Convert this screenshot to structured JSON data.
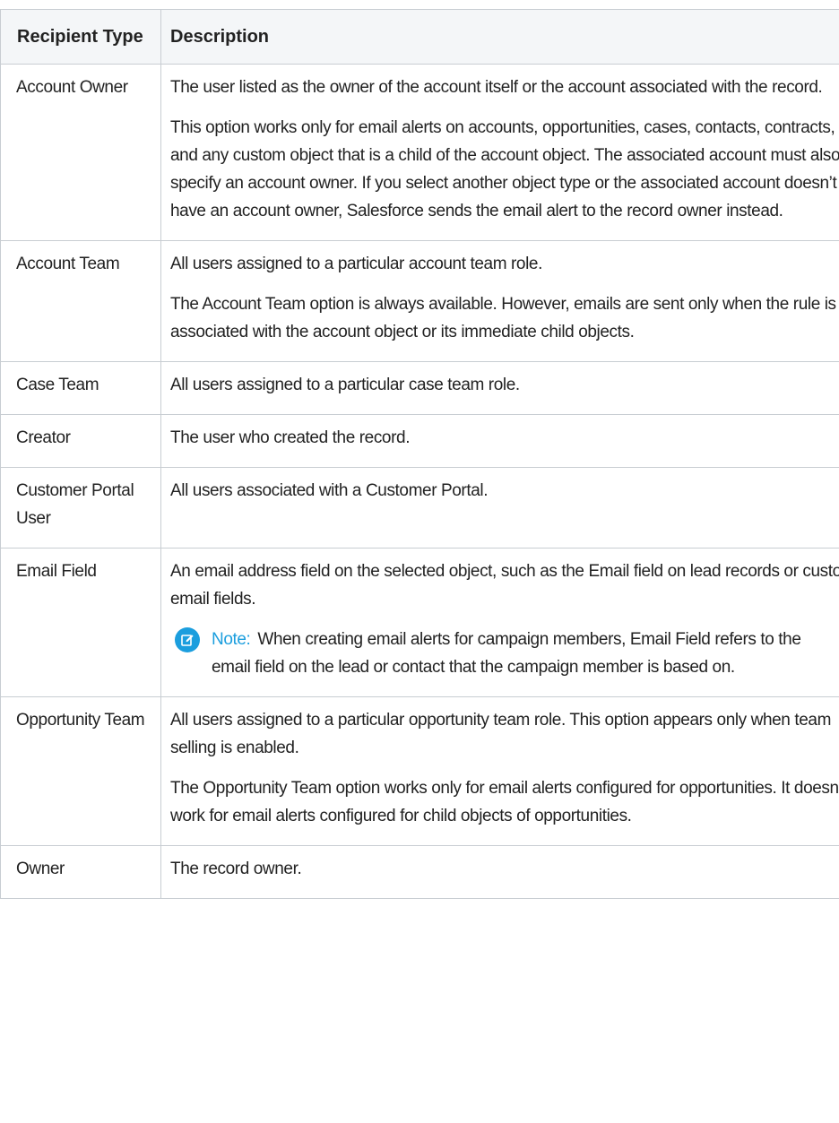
{
  "header": {
    "recipient_type": "Recipient Type",
    "description": "Description"
  },
  "rows": [
    {
      "type": "Account Owner",
      "paragraphs": [
        "The user listed as the owner of the account itself or the account associated with the record.",
        "This option works only for email alerts on accounts, opportunities, cases, contacts, contracts, and any custom object that is a child of the account object. The associated account must also specify an account owner. If you select another object type or the associated account doesn’t have an account owner, Salesforce sends the email alert to the record owner instead."
      ]
    },
    {
      "type": "Account Team",
      "paragraphs": [
        "All users assigned to a particular account team role.",
        "The Account Team option is always available. However, emails are sent only when the rule is associated with the account object or its immediate child objects."
      ]
    },
    {
      "type": "Case Team",
      "paragraphs": [
        "All users assigned to a particular case team role."
      ]
    },
    {
      "type": "Creator",
      "paragraphs": [
        "The user who created the record."
      ]
    },
    {
      "type": "Customer Portal User",
      "paragraphs": [
        "All users associated with a Customer Portal."
      ]
    },
    {
      "type": "Email Field",
      "paragraphs": [
        "An email address field on the selected object, such as the Email field on lead records or custom email fields."
      ],
      "note": {
        "icon": "edit-note-icon",
        "label": "Note:",
        "text": "When creating email alerts for campaign members, Email Field refers to the email field on the lead or contact that the campaign member is based on."
      }
    },
    {
      "type": "Opportunity Team",
      "paragraphs": [
        "All users assigned to a particular opportunity team role. This option appears only when team selling is enabled.",
        "The Opportunity Team option works only for email alerts configured for opportunities. It doesn’t work for email alerts configured for child objects of opportunities."
      ]
    },
    {
      "type": "Owner",
      "paragraphs": [
        "The record owner."
      ]
    }
  ],
  "colors": {
    "header_background": "#f4f6f8",
    "border": "#c8cdd2",
    "note_accent": "#1b9ede",
    "text": "#222222"
  }
}
